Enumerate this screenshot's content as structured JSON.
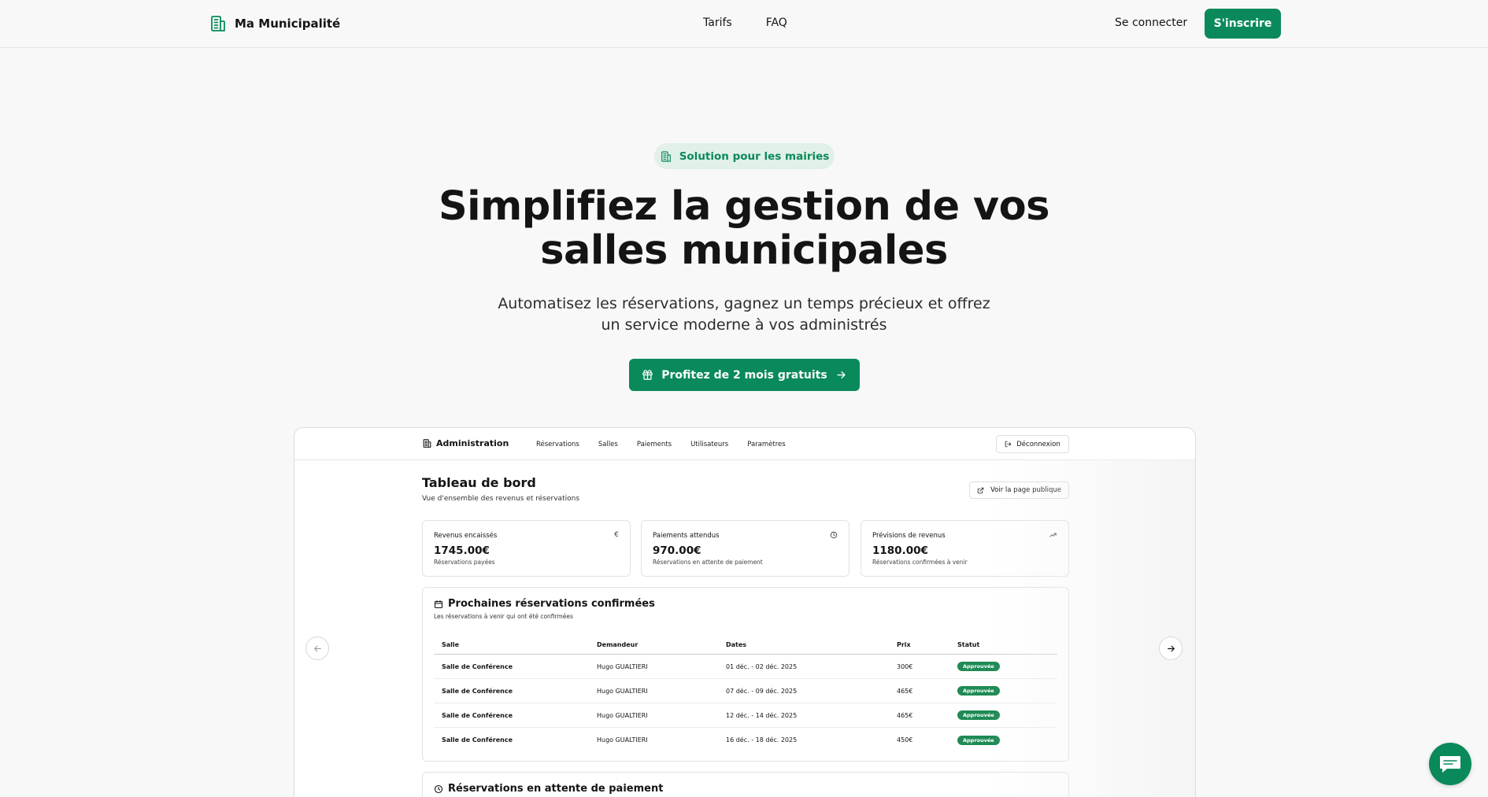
{
  "nav": {
    "brand": "Ma Municipalité",
    "links": [
      "Tarifs",
      "FAQ"
    ],
    "login": "Se connecter",
    "signup": "S'inscrire"
  },
  "hero": {
    "badge": "Solution pour les mairies",
    "title_line1": "Simplifiez la gestion de vos",
    "title_line2": "salles municipales",
    "subtitle_line1": "Automatisez les réservations, gagnez un temps précieux et offrez",
    "subtitle_line2": "un service moderne à vos administrés",
    "cta": "Profitez de 2 mois gratuits"
  },
  "preview": {
    "brand": "Administration",
    "menu": [
      "Réservations",
      "Salles",
      "Paiements",
      "Utilisateurs",
      "Paramètres"
    ],
    "logout": "Déconnexion",
    "title": "Tableau de bord",
    "subtitle": "Vue d'ensemble des revenus et réservations",
    "public_page": "Voir la page publique",
    "stats": [
      {
        "label": "Revenus encaissés",
        "icon": "€",
        "value": "1745.00€",
        "note": "Réservations payées"
      },
      {
        "label": "Paiements attendus",
        "icon": "clock-icon",
        "value": "970.00€",
        "note": "Réservations en attente de paiement"
      },
      {
        "label": "Prévisions de revenus",
        "icon": "trend-up-icon",
        "value": "1180.00€",
        "note": "Réservations confirmées à venir"
      }
    ],
    "upcoming": {
      "title": "Prochaines réservations confirmées",
      "subtitle": "Les réservations à venir qui ont été confirmées",
      "columns": [
        "Salle",
        "Demandeur",
        "Dates",
        "Prix",
        "Statut"
      ],
      "rows": [
        {
          "salle": "Salle de Conférence",
          "demandeur": "Hugo GUALTIERI",
          "dates": "01 déc. - 02 déc. 2025",
          "prix": "300€",
          "statut": "Approuvée"
        },
        {
          "salle": "Salle de Conférence",
          "demandeur": "Hugo GUALTIERI",
          "dates": "07 déc. - 09 déc. 2025",
          "prix": "465€",
          "statut": "Approuvée"
        },
        {
          "salle": "Salle de Conférence",
          "demandeur": "Hugo GUALTIERI",
          "dates": "12 déc. - 14 déc. 2025",
          "prix": "465€",
          "statut": "Approuvée"
        },
        {
          "salle": "Salle de Conférence",
          "demandeur": "Hugo GUALTIERI",
          "dates": "16 déc. - 18 déc. 2025",
          "prix": "450€",
          "statut": "Approuvée"
        }
      ]
    },
    "pending": {
      "title": "Réservations en attente de paiement"
    }
  },
  "colors": {
    "accent": "#0a8a5a",
    "badge_bg": "#e1f0e8",
    "status": "#1f8a55"
  }
}
